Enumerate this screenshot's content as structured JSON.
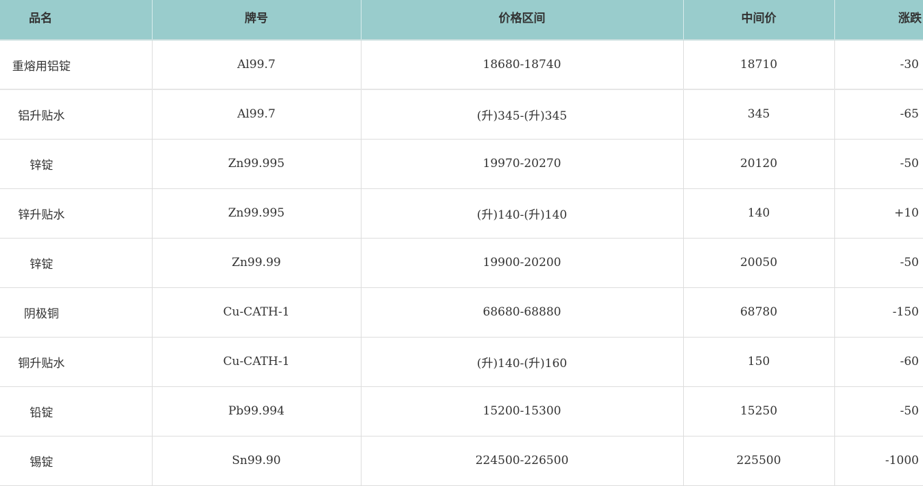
{
  "table": {
    "headers": [
      "品名",
      "牌号",
      "价格区间",
      "中间价",
      "涨跌"
    ],
    "rows": [
      [
        "重熔用铝锭",
        "Al99.7",
        "18680-18740",
        "18710",
        "-30"
      ],
      [
        "铝升贴水",
        "Al99.7",
        "(升)345-(升)345",
        "345",
        "-65"
      ],
      [
        "锌锭",
        "Zn99.995",
        "19970-20270",
        "20120",
        "-50"
      ],
      [
        "锌升贴水",
        "Zn99.995",
        "(升)140-(升)140",
        "140",
        "+10"
      ],
      [
        "锌锭",
        "Zn99.99",
        "19900-20200",
        "20050",
        "-50"
      ],
      [
        "阴极铜",
        "Cu-CATH-1",
        "68680-68880",
        "68780",
        "-150"
      ],
      [
        "铜升贴水",
        "Cu-CATH-1",
        "(升)140-(升)160",
        "150",
        "-60"
      ],
      [
        "铅锭",
        "Pb99.994",
        "15200-15300",
        "15250",
        "-50"
      ],
      [
        "锡锭",
        "Sn99.90",
        "224500-226500",
        "225500",
        "-1000"
      ]
    ]
  }
}
